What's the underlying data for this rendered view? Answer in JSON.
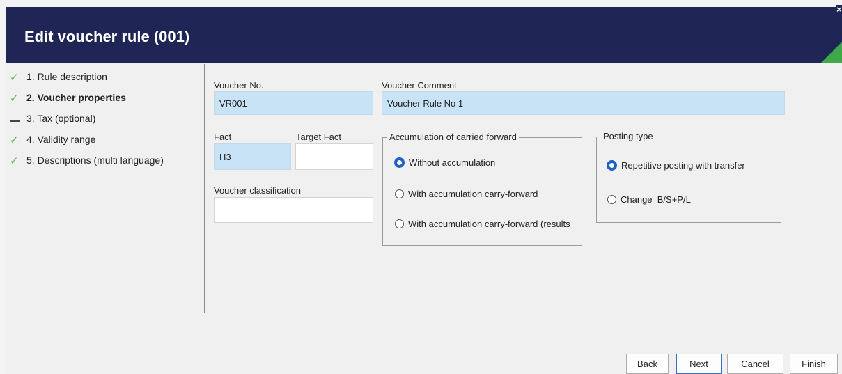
{
  "dialog": {
    "title": "Edit voucher rule (001)",
    "close_glyph": "×",
    "header_color": "#1f2555",
    "accent_color": "#3ea84a"
  },
  "steps": [
    {
      "label": "1. Rule description",
      "status": "done",
      "icon": "check-icon"
    },
    {
      "label": "2. Voucher properties",
      "status": "current",
      "icon": "check-icon"
    },
    {
      "label": "3. Tax (optional)",
      "status": "skipped",
      "icon": "dash-icon"
    },
    {
      "label": "4. Validity range",
      "status": "done",
      "icon": "check-icon"
    },
    {
      "label": "5. Descriptions (multi language)",
      "status": "done",
      "icon": "check-icon"
    }
  ],
  "form": {
    "voucher_no": {
      "label": "Voucher No.",
      "value": "VR001"
    },
    "voucher_comment": {
      "label": "Voucher Comment",
      "value": "Voucher Rule No 1"
    },
    "fact": {
      "label": "Fact",
      "value": "H3"
    },
    "target_fact": {
      "label": "Target Fact",
      "value": ""
    },
    "voucher_classification": {
      "label": "Voucher classification",
      "value": ""
    }
  },
  "accumulation": {
    "legend": "Accumulation of carried forward",
    "options": [
      {
        "label": "Without accumulation",
        "selected": true
      },
      {
        "label": "With accumulation carry-forward",
        "selected": false
      },
      {
        "label": "With accumulation carry-forward (results",
        "selected": false
      }
    ]
  },
  "posting_type": {
    "legend": "Posting type",
    "options": [
      {
        "label": "Repetitive posting with transfer",
        "selected": true
      },
      {
        "label": "Change  B/S+P/L",
        "selected": false
      }
    ]
  },
  "buttons": {
    "back": "Back",
    "next": "Next",
    "cancel": "Cancel",
    "finish": "Finish"
  },
  "colors": {
    "selected_field": "#c8e2f6",
    "radio_selected": "#1b62c3",
    "check": "#5ab552"
  }
}
